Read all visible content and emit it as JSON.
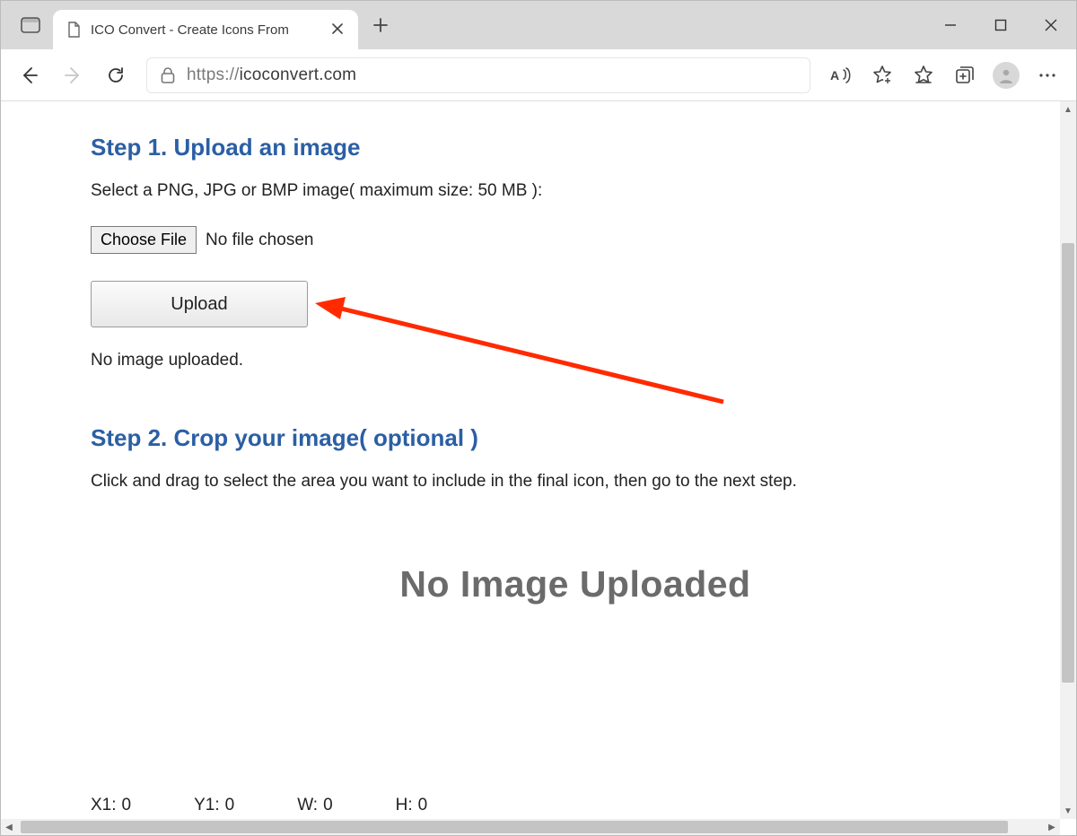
{
  "window": {
    "tab_title": "ICO Convert - Create Icons From"
  },
  "toolbar": {
    "url_scheme": "https://",
    "url_host": "icoconvert.com"
  },
  "page": {
    "step1": {
      "heading": "Step 1. Upload an image",
      "instruction": "Select a PNG, JPG or BMP image( maximum size: 50 MB ):",
      "choose_label": "Choose File",
      "no_file_label": "No file chosen",
      "upload_label": "Upload",
      "status": "No image uploaded."
    },
    "step2": {
      "heading": "Step 2. Crop your image( optional )",
      "instruction": "Click and drag to select the area you want to include in the final icon, then go to the next step."
    },
    "placeholder": "No Image Uploaded",
    "coords": {
      "x1_label": "X1:",
      "x1_val": "0",
      "y1_label": "Y1:",
      "y1_val": "0",
      "w_label": "W:",
      "w_val": "0",
      "h_label": "H:",
      "h_val": "0"
    }
  }
}
